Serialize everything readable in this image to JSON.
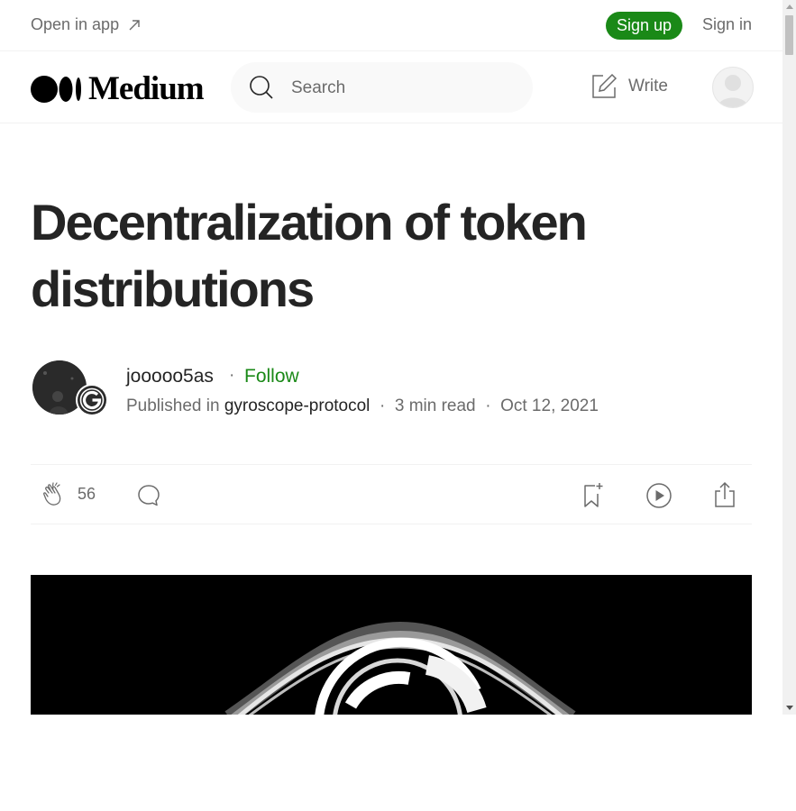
{
  "top_bar": {
    "open_in_app": "Open in app",
    "sign_up": "Sign up",
    "sign_in": "Sign in"
  },
  "header": {
    "logo_text": "Medium",
    "search_placeholder": "Search",
    "write_label": "Write"
  },
  "article": {
    "title": "Decentralization of token distributions",
    "author": "jooooo5as",
    "follow_label": "Follow",
    "published_in_label": "Published in",
    "publication": "gyroscope-protocol",
    "read_time": "3 min read",
    "date": "Oct 12, 2021",
    "separator": "·",
    "claps": "56"
  },
  "colors": {
    "accent_green": "#1a8917",
    "text_primary": "#242424",
    "text_secondary": "#6b6b6b"
  },
  "icons": [
    "arrow-up-right-icon",
    "medium-logo-icon",
    "search-icon",
    "write-icon",
    "avatar-icon",
    "clap-icon",
    "comment-icon",
    "bookmark-add-icon",
    "play-icon",
    "share-icon"
  ]
}
